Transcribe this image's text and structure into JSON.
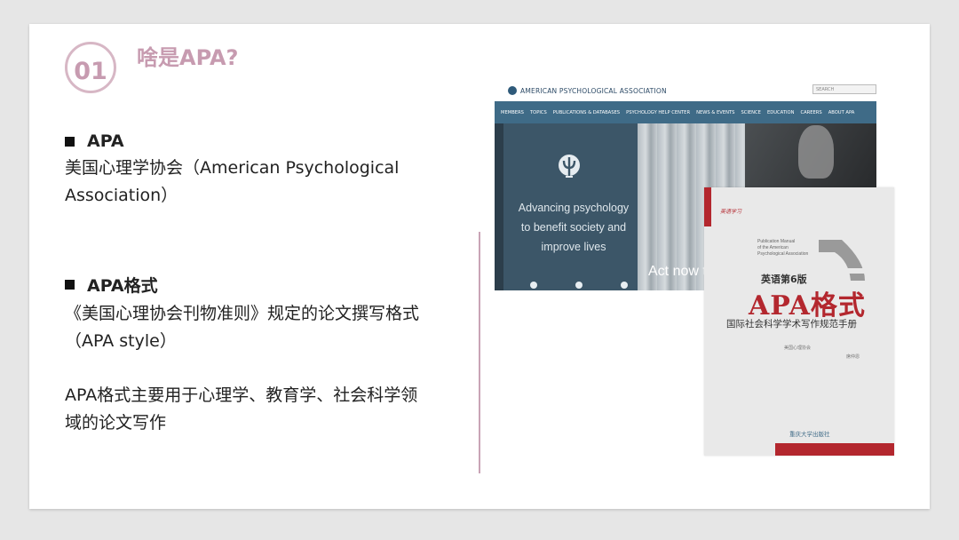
{
  "section": {
    "number": "01",
    "title": "啥是APA?"
  },
  "left": {
    "item1": {
      "heading": "APA",
      "line1": "美国心理学协会（American Psychological",
      "line2": "Association）"
    },
    "item2": {
      "heading": "APA格式",
      "line1": "《美国心理协会刊物准则》规定的论文撰写格式",
      "line2": "（APA style）"
    },
    "note": {
      "line1": "APA格式主要用于心理学、教育学、社会科学领",
      "line2": "域的论文写作"
    }
  },
  "website": {
    "site_name": "AMERICAN PSYCHOLOGICAL ASSOCIATION",
    "search_placeholder": "SEARCH",
    "nav": [
      "MEMBERS",
      "TOPICS",
      "PUBLICATIONS & DATABASES",
      "PSYCHOLOGY HELP CENTER",
      "NEWS & EVENTS",
      "SCIENCE",
      "EDUCATION",
      "CAREERS",
      "ABOUT APA"
    ],
    "hero_line1": "Advancing psychology",
    "hero_line2": "to benefit society and",
    "hero_line3": "improve lives",
    "act_now": "Act now t"
  },
  "book": {
    "series": "英语学习",
    "english_title_1": "Publication Manual",
    "english_title_2": "of the American",
    "english_title_3": "Psychological Association",
    "edition": "英语第6版",
    "title": "APA格式",
    "subtitle": "国际社会科学学术写作规范手册",
    "author": "美国心理协会",
    "translator": "席仲恩",
    "publisher": "重庆大学出版社"
  }
}
